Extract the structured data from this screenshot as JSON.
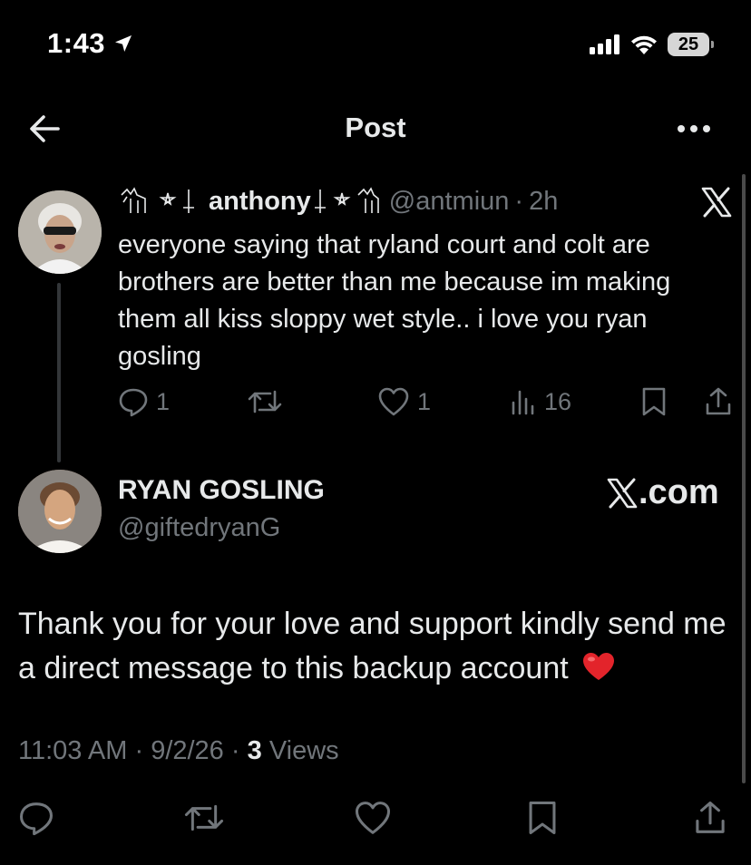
{
  "status_bar": {
    "time": "1:43",
    "battery": "25",
    "icons": [
      "location-arrow-icon",
      "cellular-signal-icon",
      "wifi-icon",
      "battery-icon"
    ]
  },
  "header": {
    "title": "Post",
    "back_icon": "arrow-left-icon",
    "more_icon": "more-dots-icon"
  },
  "parent_post": {
    "display_name": "anthony",
    "name_decorations": "goat-and-pentagram-emoji",
    "handle": "@antmiun",
    "separator": "·",
    "time": "2h",
    "text": "everyone saying that ryland court and colt are brothers are better than me because im making them all kiss sloppy wet style.. i love you ryan gosling",
    "actions": {
      "replies": "1",
      "reposts": "",
      "likes": "1",
      "views": "16"
    },
    "x_logo": "x-logo-icon"
  },
  "main_post": {
    "display_name": "RYAN GOSLING",
    "handle": "@giftedryanG",
    "link_label": ".com",
    "text": "Thank you for your love and support kindly send me a direct message to this backup account",
    "emoji": "red-heart-emoji",
    "timestamp": "11:03 AM",
    "date": "9/2/26",
    "meta_separator": "·",
    "views_count": "3",
    "views_label": "Views"
  },
  "bottom_actions": [
    "reply-icon",
    "repost-icon",
    "like-icon",
    "bookmark-icon",
    "share-icon"
  ],
  "colors": {
    "background": "#000000",
    "primary_text": "#e7e9ea",
    "secondary_text": "#71767b",
    "thread_line": "#333639",
    "heart": "#e3242b"
  }
}
